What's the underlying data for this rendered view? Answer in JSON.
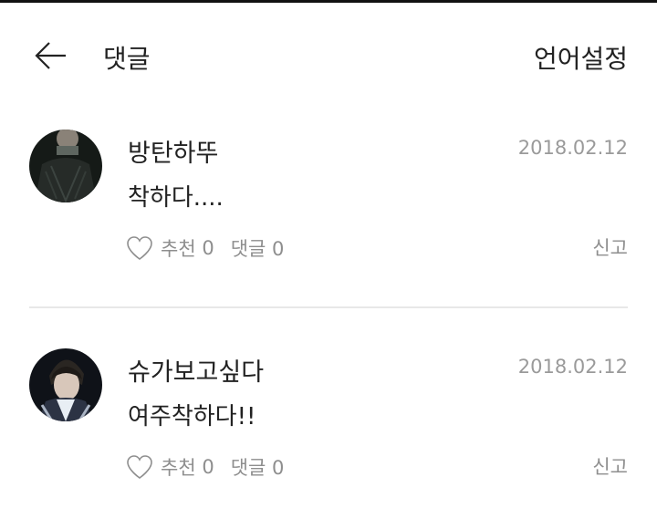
{
  "header": {
    "title": "댓글",
    "language_settings": "언어설정",
    "back_icon": "arrow-left-icon"
  },
  "comments": [
    {
      "author": "방탄하뚜",
      "date": "2018.02.12",
      "text": "착하다....",
      "like_label": "추천",
      "like_count": "0",
      "reply_label": "댓글",
      "reply_count": "0",
      "report_label": "신고"
    },
    {
      "author": "슈가보고싶다",
      "date": "2018.02.12",
      "text": "여주착하다!!",
      "like_label": "추천",
      "like_count": "0",
      "reply_label": "댓글",
      "reply_count": "0",
      "report_label": "신고"
    }
  ],
  "colors": {
    "text": "#222222",
    "meta": "#9a9a9a",
    "divider": "#e8e8e8",
    "background": "#ffffff"
  }
}
